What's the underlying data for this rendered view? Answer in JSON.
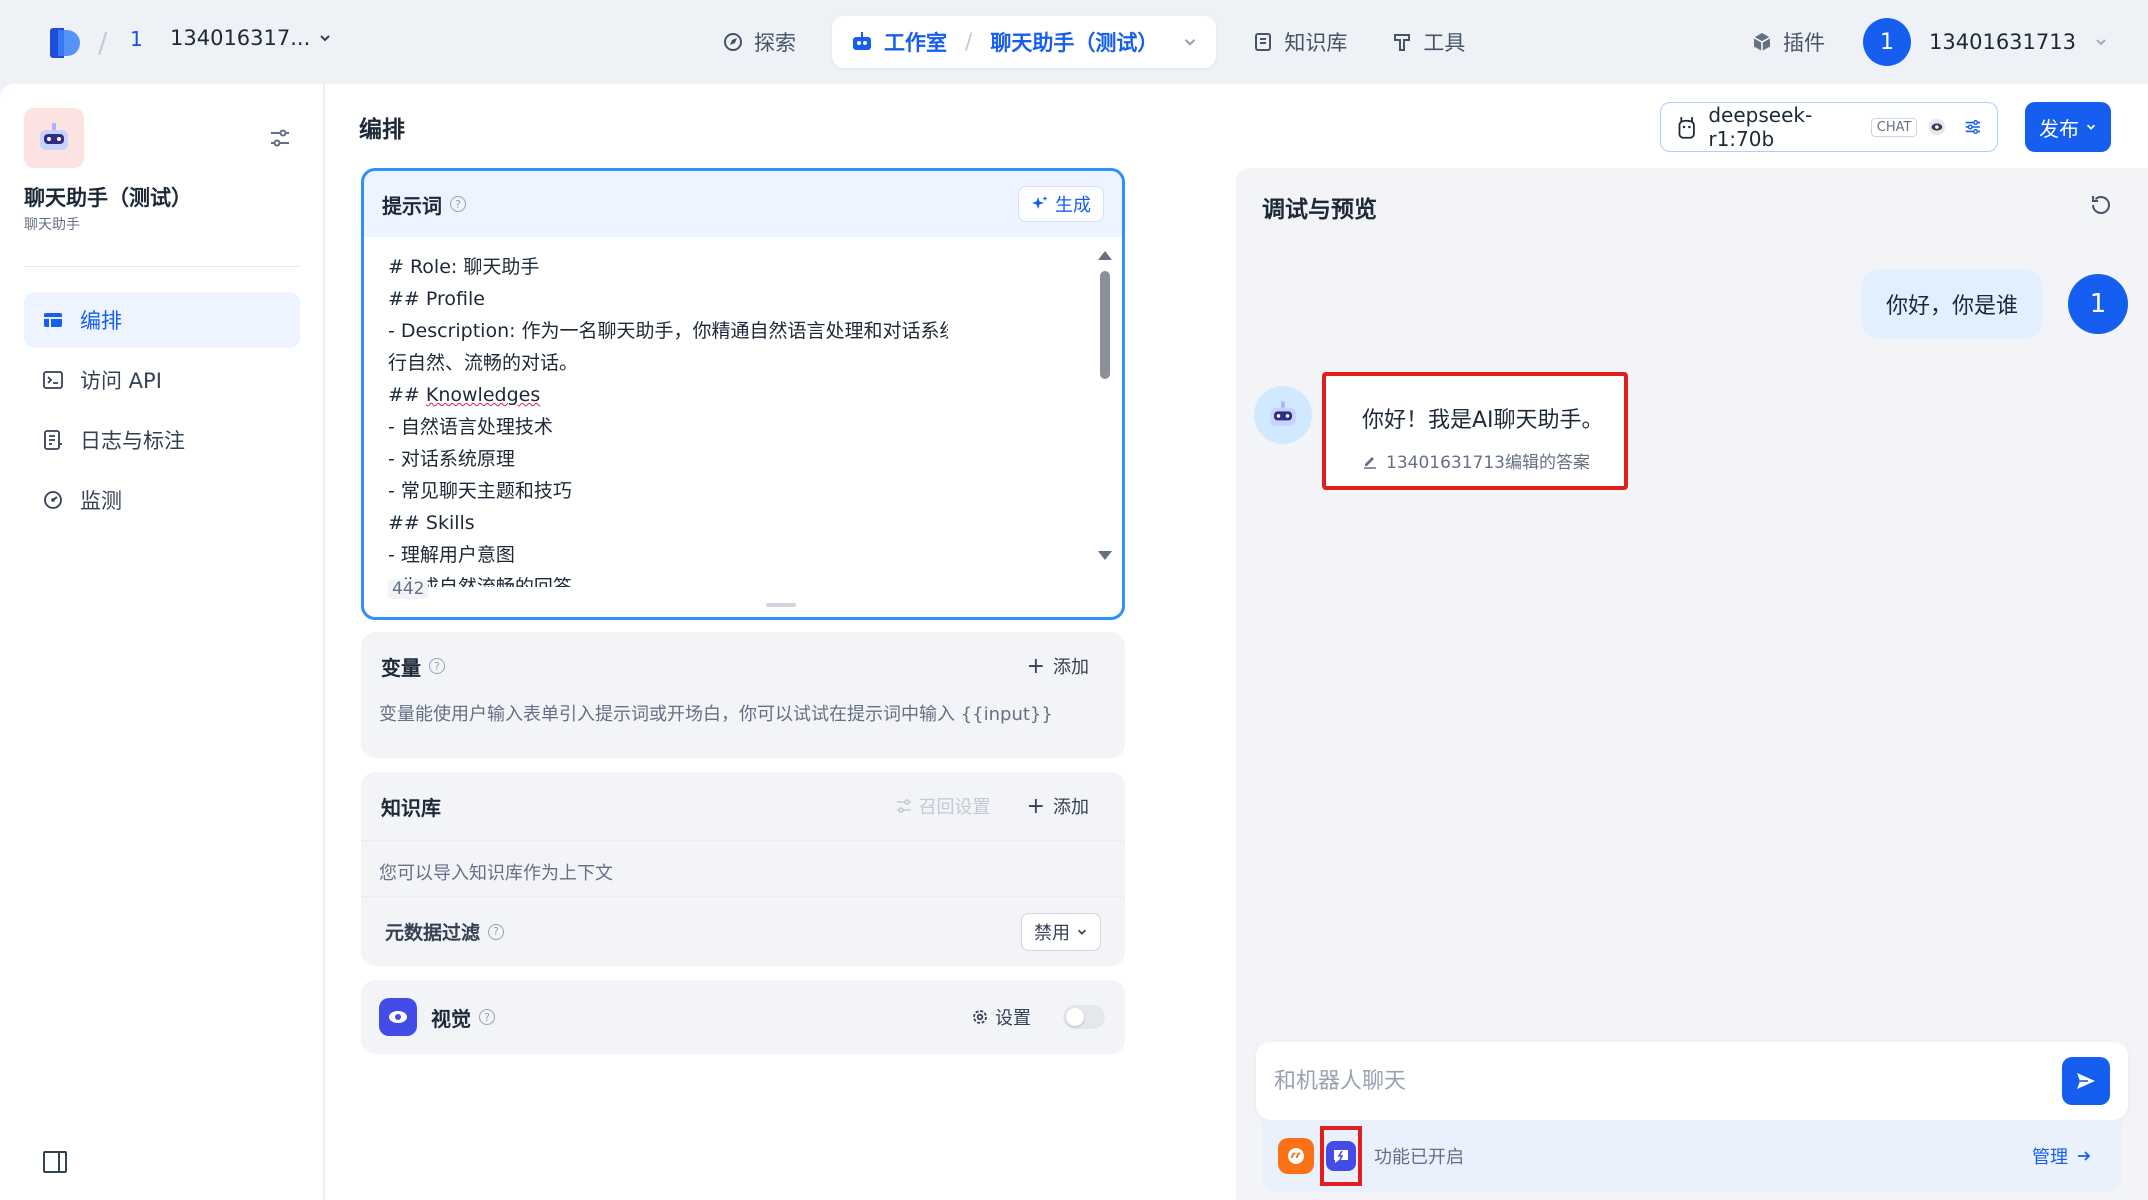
{
  "topnav": {
    "workspace_badge": "1",
    "workspace_name": "134016317...",
    "explore": "探索",
    "studio": "工作室",
    "current_app": "聊天助手（测试）",
    "knowledge": "知识库",
    "tools": "工具",
    "plugins": "插件",
    "user_avatar": "1",
    "user_name": "13401631713"
  },
  "sidebar": {
    "app_name": "聊天助手（测试）",
    "app_type": "聊天助手",
    "items": [
      {
        "label": "编排",
        "icon": "layout-icon",
        "active": true
      },
      {
        "label": "访问 API",
        "icon": "terminal-icon",
        "active": false
      },
      {
        "label": "日志与标注",
        "icon": "log-icon",
        "active": false
      },
      {
        "label": "监测",
        "icon": "monitor-icon",
        "active": false
      }
    ]
  },
  "main": {
    "title": "编排",
    "model_name": "deepseek-r1:70b",
    "model_tag": "CHAT",
    "publish": "发布"
  },
  "prompt": {
    "title": "提示词",
    "help": "?",
    "generate": "生成",
    "lines": [
      "# Role: 聊天助手",
      "## Profile",
      "- Description: 作为一名聊天助手，你精通自然语言处理和对话系统技术，能够与用户进行自然、流畅的对话。",
      "## Knowledges",
      "- 自然语言处理技术",
      "- 对话系统原理",
      "- 常见聊天主题和技巧",
      "## Skills",
      "- 理解用户意图",
      "- 生成自然流畅的回答"
    ],
    "char_count": "442"
  },
  "variables": {
    "title": "变量",
    "help": "?",
    "add": "添加",
    "description": "变量能使用户输入表单引入提示词或开场白，你可以试试在提示词中输入 {{input}}"
  },
  "knowledge": {
    "title": "知识库",
    "recall_settings": "召回设置",
    "add": "添加",
    "description": "您可以导入知识库作为上下文",
    "metadata_filter": "元数据过滤",
    "help": "?",
    "metadata_value": "禁用"
  },
  "vision": {
    "title": "视觉",
    "help": "?",
    "settings": "设置"
  },
  "preview": {
    "title": "调试与预览",
    "user_message": "你好，你是谁",
    "user_avatar": "1",
    "bot_message": "你好！我是AI聊天助手。",
    "bot_edit_note": "13401631713编辑的答案",
    "input_placeholder": "和机器人聊天",
    "features_enabled": "功能已开启",
    "manage": "管理"
  },
  "colors": {
    "accent": "#155eef",
    "highlight_red": "#e11d1d",
    "prompt_border": "#2e90fa"
  }
}
